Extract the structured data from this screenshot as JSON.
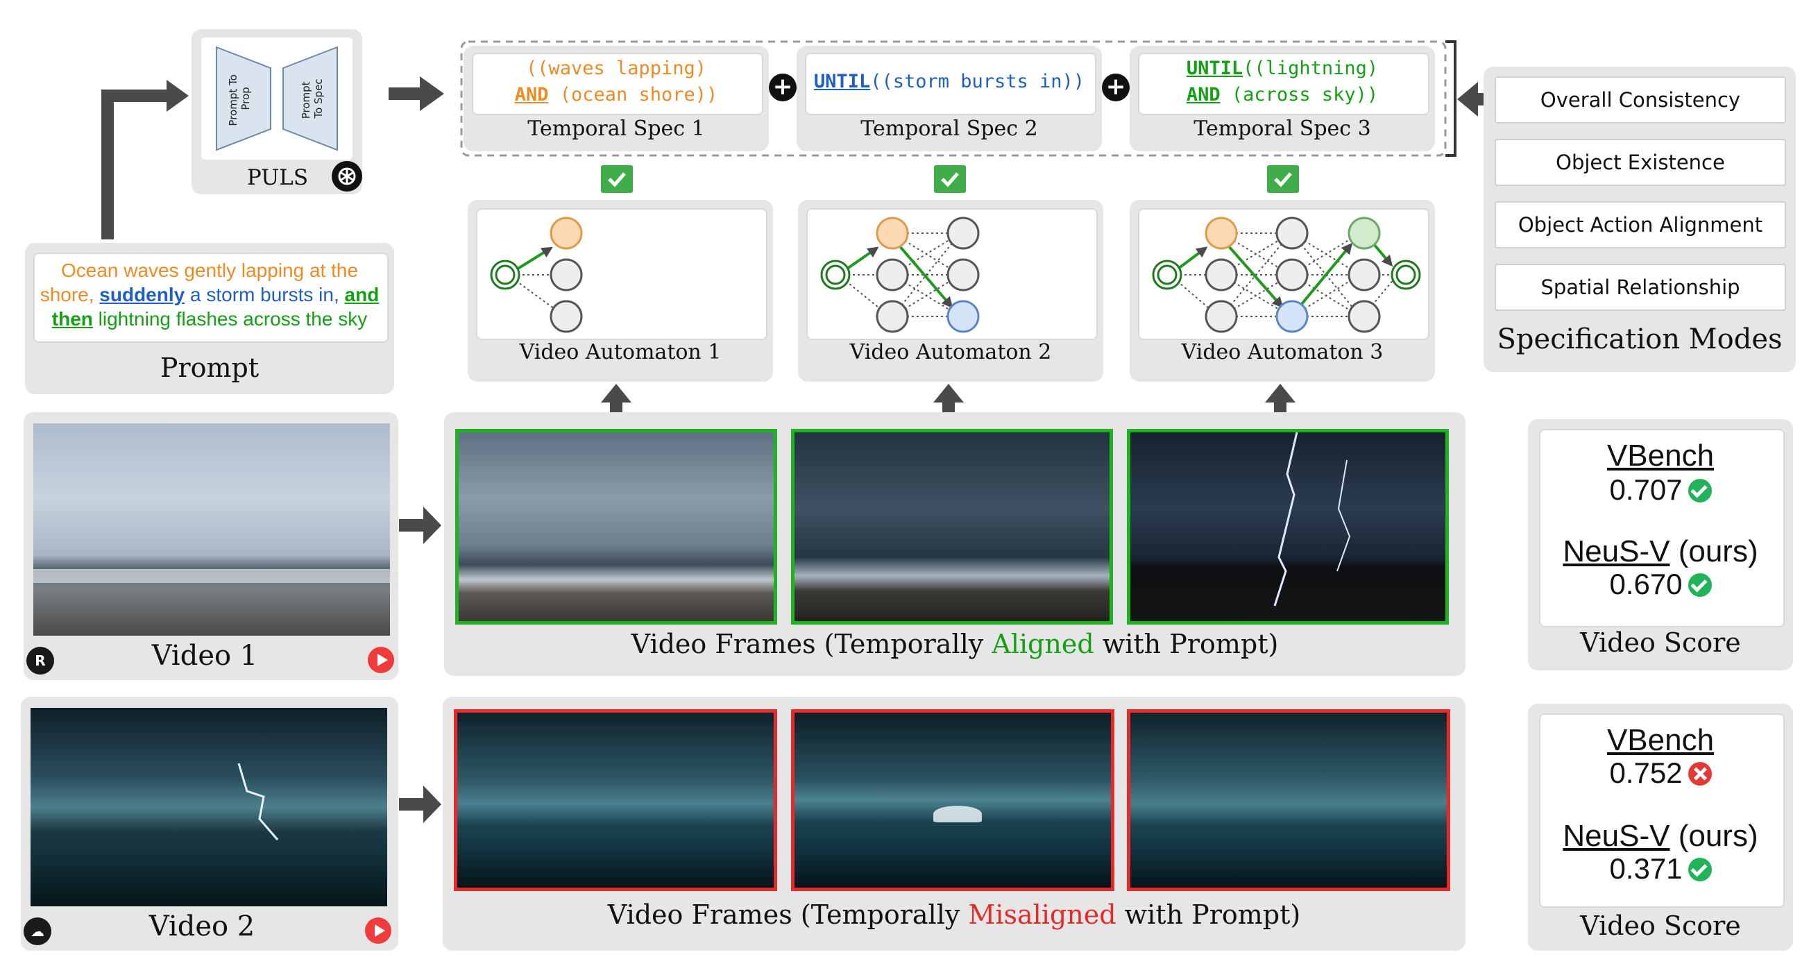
{
  "puls": {
    "label": "PULS",
    "left_block": "Prompt To Prop",
    "right_block": "Prompt To Spec",
    "left_lines": [
      "Prompt To",
      "Prop"
    ],
    "right_lines": [
      "Prompt",
      "To Spec"
    ]
  },
  "prompt": {
    "caption": "Prompt",
    "lines": [
      [
        {
          "t": "Ocean waves gently lapping at the",
          "c": "orange"
        }
      ],
      [
        {
          "t": "shore, ",
          "c": "orange"
        },
        {
          "t": "suddenly",
          "c": "blue",
          "u": true
        },
        {
          "t": " a storm bursts in, ",
          "c": "blue"
        },
        {
          "t": "and",
          "c": "green",
          "u": true
        }
      ],
      [
        {
          "t": "then",
          "c": "green",
          "u": true
        },
        {
          "t": " lightning flashes across the sky",
          "c": "green"
        }
      ]
    ]
  },
  "temporal_specs": [
    {
      "caption": "Temporal Spec 1",
      "line1": "((waves lapping)",
      "line2_kw": "AND",
      "line2_rest": " (ocean shore))",
      "color": "orange"
    },
    {
      "caption": "Temporal Spec 2",
      "line1_kw": "UNTIL",
      "line1_rest": "((storm bursts in))",
      "color": "blue"
    },
    {
      "caption": "Temporal Spec 3",
      "line1_kw": "UNTIL",
      "line1_rest": "((lightning)",
      "line2_kw": "AND",
      "line2_rest": " (across sky))",
      "color": "green"
    }
  ],
  "automata": [
    {
      "caption": "Video Automaton 1"
    },
    {
      "caption": "Video Automaton 2"
    },
    {
      "caption": "Video Automaton 3"
    }
  ],
  "spec_modes": {
    "title": "Specification Modes",
    "items": [
      "Overall Consistency",
      "Object Existence",
      "Object Action Alignment",
      "Spatial Relationship"
    ]
  },
  "video1": {
    "caption": "Video 1",
    "frames_caption_pre": "Video Frames (Temporally ",
    "frames_caption_word": "Aligned",
    "frames_caption_post": " with Prompt)",
    "score": {
      "caption": "Video Score",
      "vbench_label": "VBench",
      "vbench_value": "0.707",
      "vbench_ok": true,
      "neusv_label": "NeuS-V",
      "neusv_suffix": " (ours)",
      "neusv_value": "0.670",
      "neusv_ok": true
    }
  },
  "video2": {
    "caption": "Video 2",
    "frames_caption_pre": "Video Frames (Temporally ",
    "frames_caption_word": "Misaligned",
    "frames_caption_post": " with Prompt)",
    "score": {
      "caption": "Video Score",
      "vbench_label": "VBench",
      "vbench_value": "0.752",
      "vbench_ok": false,
      "neusv_label": "NeuS-V",
      "neusv_suffix": " (ours)",
      "neusv_value": "0.371",
      "neusv_ok": true
    }
  },
  "colors": {
    "aligned": "#14a014",
    "misaligned": "#e52a2a",
    "orange": "#f08a24",
    "blue": "#1f5fbf",
    "green": "#14a014"
  }
}
